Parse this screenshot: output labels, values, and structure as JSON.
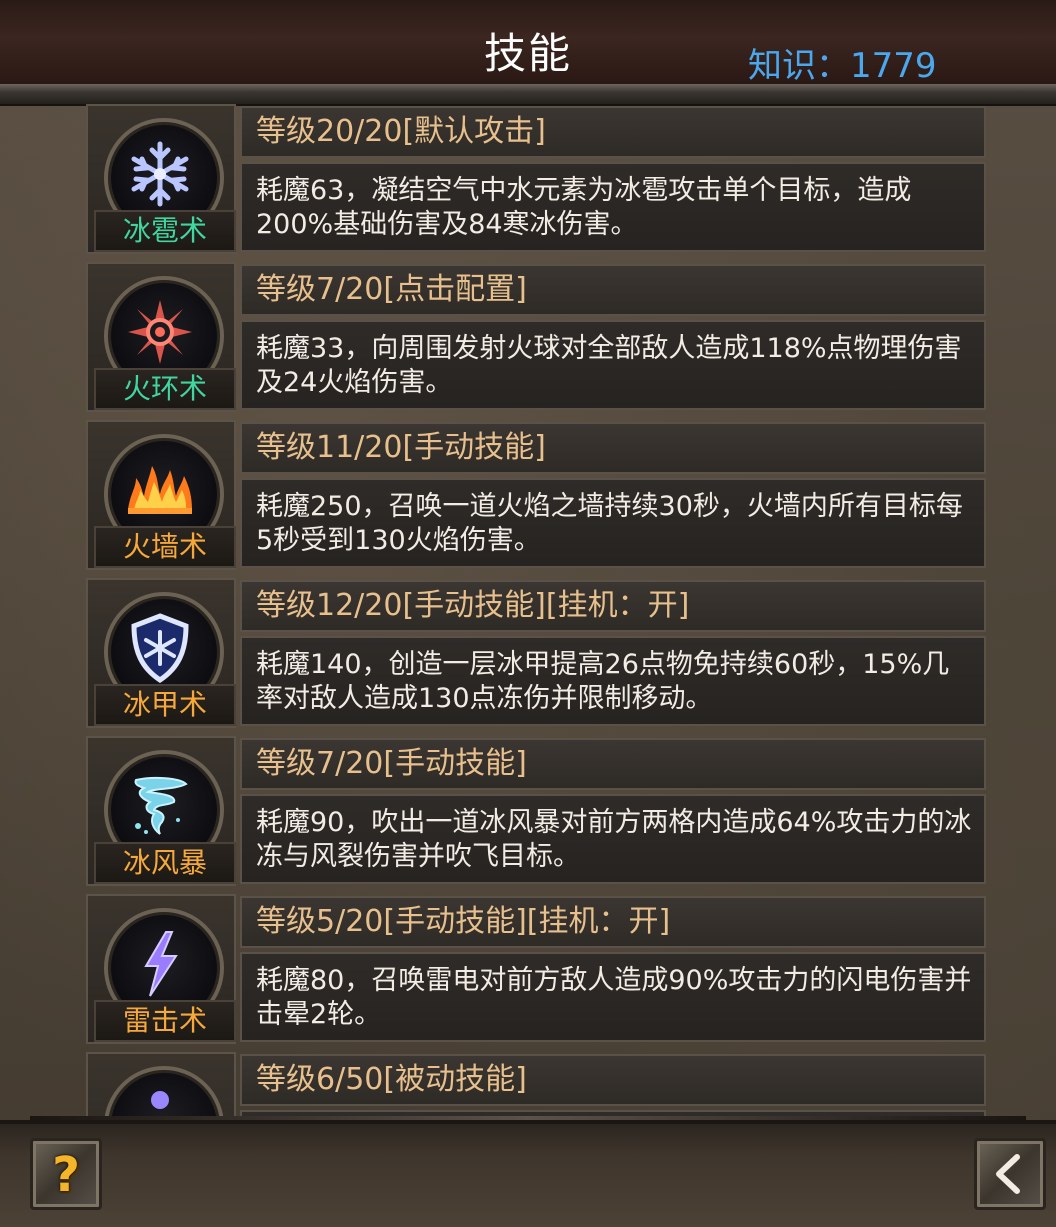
{
  "header": {
    "title": "技能",
    "knowledge": "知识：1779"
  },
  "colors": {
    "name_green": "#3fd6a0",
    "name_orange": "#f6a83a",
    "level_text": "#e7c08d",
    "desc_text": "#f2ece4",
    "knowledge_blue": "#4aa8ef"
  },
  "skills": [
    {
      "name": "冰雹术",
      "name_color": "green",
      "icon": "snowflake-icon",
      "level": "等级20/20[默认攻击]",
      "desc": "耗魔63，凝结空气中水元素为冰雹攻击单个目标，造成200%基础伤害及84寒冰伤害。"
    },
    {
      "name": "火环术",
      "name_color": "green",
      "icon": "fire-ring-icon",
      "level": "等级7/20[点击配置]",
      "desc": "耗魔33，向周围发射火球对全部敌人造成118%点物理伤害及24火焰伤害。"
    },
    {
      "name": "火墙术",
      "name_color": "orange",
      "icon": "fire-wall-icon",
      "level": "等级11/20[手动技能]",
      "desc": "耗魔250，召唤一道火焰之墙持续30秒，火墙内所有目标每5秒受到130火焰伤害。"
    },
    {
      "name": "冰甲术",
      "name_color": "orange",
      "icon": "ice-shield-icon",
      "level": "等级12/20[手动技能][挂机：开]",
      "desc": "耗魔140，创造一层冰甲提高26点物免持续60秒，15%几率对敌人造成130点冻伤并限制移动。"
    },
    {
      "name": "冰风暴",
      "name_color": "orange",
      "icon": "tornado-icon",
      "level": "等级7/20[手动技能]",
      "desc": "耗魔90，吹出一道冰风暴对前方两格内造成64%攻击力的冰冻与风裂伤害并吹飞目标。"
    },
    {
      "name": "雷击术",
      "name_color": "orange",
      "icon": "lightning-icon",
      "level": "等级5/20[手动技能][挂机：开]",
      "desc": "耗魔80，召唤雷电对前方敌人造成90%攻击力的闪电伤害并击晕2轮。"
    },
    {
      "name": "",
      "name_color": "orange",
      "icon": "meditate-icon",
      "level": "等级6/50[被动技能]",
      "desc": ""
    }
  ],
  "footer": {
    "help_label": "?",
    "back_icon": "back-arrow-icon"
  }
}
